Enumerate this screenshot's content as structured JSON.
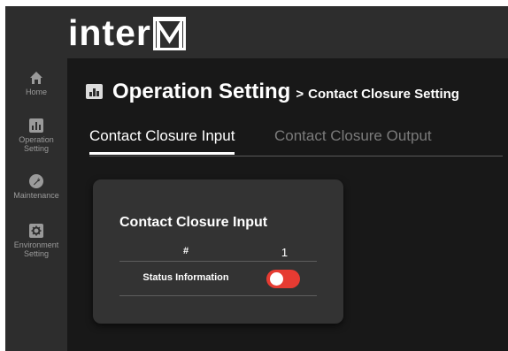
{
  "brand": {
    "logo_text": "inter",
    "logo_letter": "M"
  },
  "sidebar": {
    "items": [
      {
        "label": "Home",
        "icon": "home-icon"
      },
      {
        "label": "Operation Setting",
        "icon": "chart-icon"
      },
      {
        "label": "Maintenance",
        "icon": "wrench-icon"
      },
      {
        "label": "Environment Setting",
        "icon": "gear-icon"
      }
    ]
  },
  "page": {
    "title": "Operation Setting",
    "separator": ">",
    "subtitle": "Contact Closure Setting"
  },
  "tabs": [
    {
      "label": "Contact Closure Input",
      "active": true
    },
    {
      "label": "Contact Closure Output",
      "active": false
    }
  ],
  "card": {
    "title": "Contact Closure Input",
    "header": {
      "col_label": "#",
      "col_value": "1"
    },
    "rows": [
      {
        "label": "Status Information",
        "toggle_state": "on"
      }
    ]
  },
  "colors": {
    "background": "#181818",
    "bar": "#2d2d2d",
    "card": "#333333",
    "toggle_on": "#e63b32",
    "inactive_text": "#7b7b7b"
  }
}
